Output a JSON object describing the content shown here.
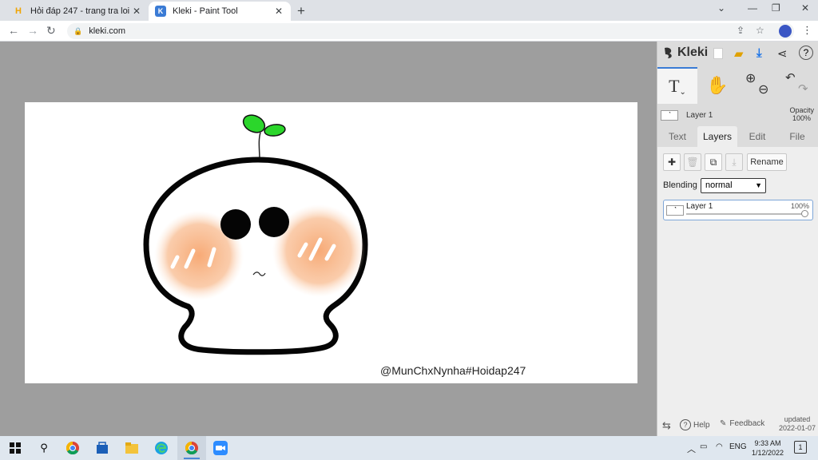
{
  "browser": {
    "tabs": [
      {
        "title": "Hỏi đáp 247 - trang tra loi",
        "favicon": "H",
        "active": false
      },
      {
        "title": "Kleki - Paint Tool",
        "favicon": "K",
        "active": true
      }
    ],
    "new_tab": "+",
    "url": "kleki.com",
    "window_controls": {
      "chevron": "⌄",
      "minimize": "—",
      "restore": "❐",
      "close": "✕"
    }
  },
  "canvas": {
    "signature": "@MunChxNynha#Hoidap247",
    "face": "~"
  },
  "panel": {
    "brand": "Kleki",
    "tools": {
      "text": "T",
      "text_caret": "⌄"
    },
    "mini_layer": {
      "name": "Layer 1",
      "opacity_label": "Opacity",
      "opacity_value": "100%"
    },
    "tabs": [
      "Text",
      "Layers",
      "Edit",
      "File"
    ],
    "active_tab": "Layers",
    "buttons": {
      "add": "✚",
      "rename": "Rename"
    },
    "blending": {
      "label": "Blending",
      "value": "normal"
    },
    "layers": [
      {
        "name": "Layer 1",
        "opacity": "100%",
        "opacity_fraction": 1.0
      }
    ],
    "footer": {
      "help": "Help",
      "feedback": "Feedback",
      "updated_label": "updated",
      "updated_date": "2022-01-07"
    }
  },
  "taskbar": {
    "tray": {
      "language": "ENG",
      "time": "9:33 AM",
      "date": "1/12/2022",
      "notifications": "1"
    }
  },
  "colors": {
    "leaf_green": "#22cc22",
    "blush": "#f8b888",
    "accent_blue": "#3a7bd5"
  }
}
